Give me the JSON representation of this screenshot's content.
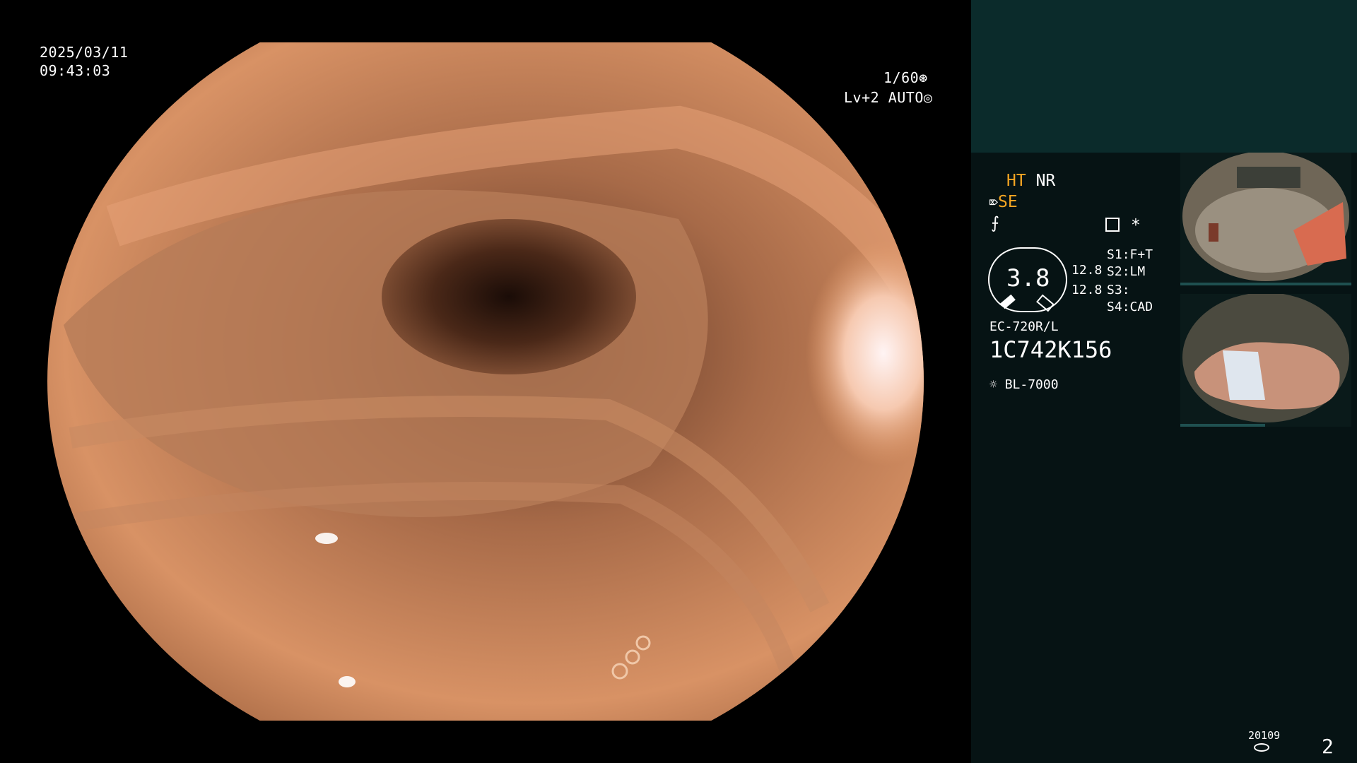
{
  "datetime": {
    "date": "2025/03/11",
    "time": "09:43:03"
  },
  "exposure": {
    "shutter": "1/60",
    "level": "Lv+2",
    "mode": "AUTO"
  },
  "status": {
    "ht": "HT",
    "nr": "NR",
    "se": "SE",
    "scope_value": "3.8",
    "value_top": "12.8",
    "value_bottom": "12.8",
    "s1_label": "S1",
    "s1_value": "F+T",
    "s2_label": "S2",
    "s2_value": "LM",
    "s3_label": "S3",
    "s3_value": "",
    "s4_label": "S4",
    "s4_value": "CAD",
    "scope_model": "EC-720R/L",
    "serial": "1C742K156",
    "light_source": "BL-7000",
    "star": "*"
  },
  "footer": {
    "record_id": "20109",
    "page": "2"
  },
  "icons": [
    "shutter-icon",
    "auto-iris-icon",
    "se-mode-icon",
    "f-mode-icon",
    "memo-icon",
    "light-source-icon",
    "disk-icon"
  ],
  "colors": {
    "accent": "#f5a623",
    "panel_bg": "#061314",
    "panel_top": "#0b2b2b"
  }
}
